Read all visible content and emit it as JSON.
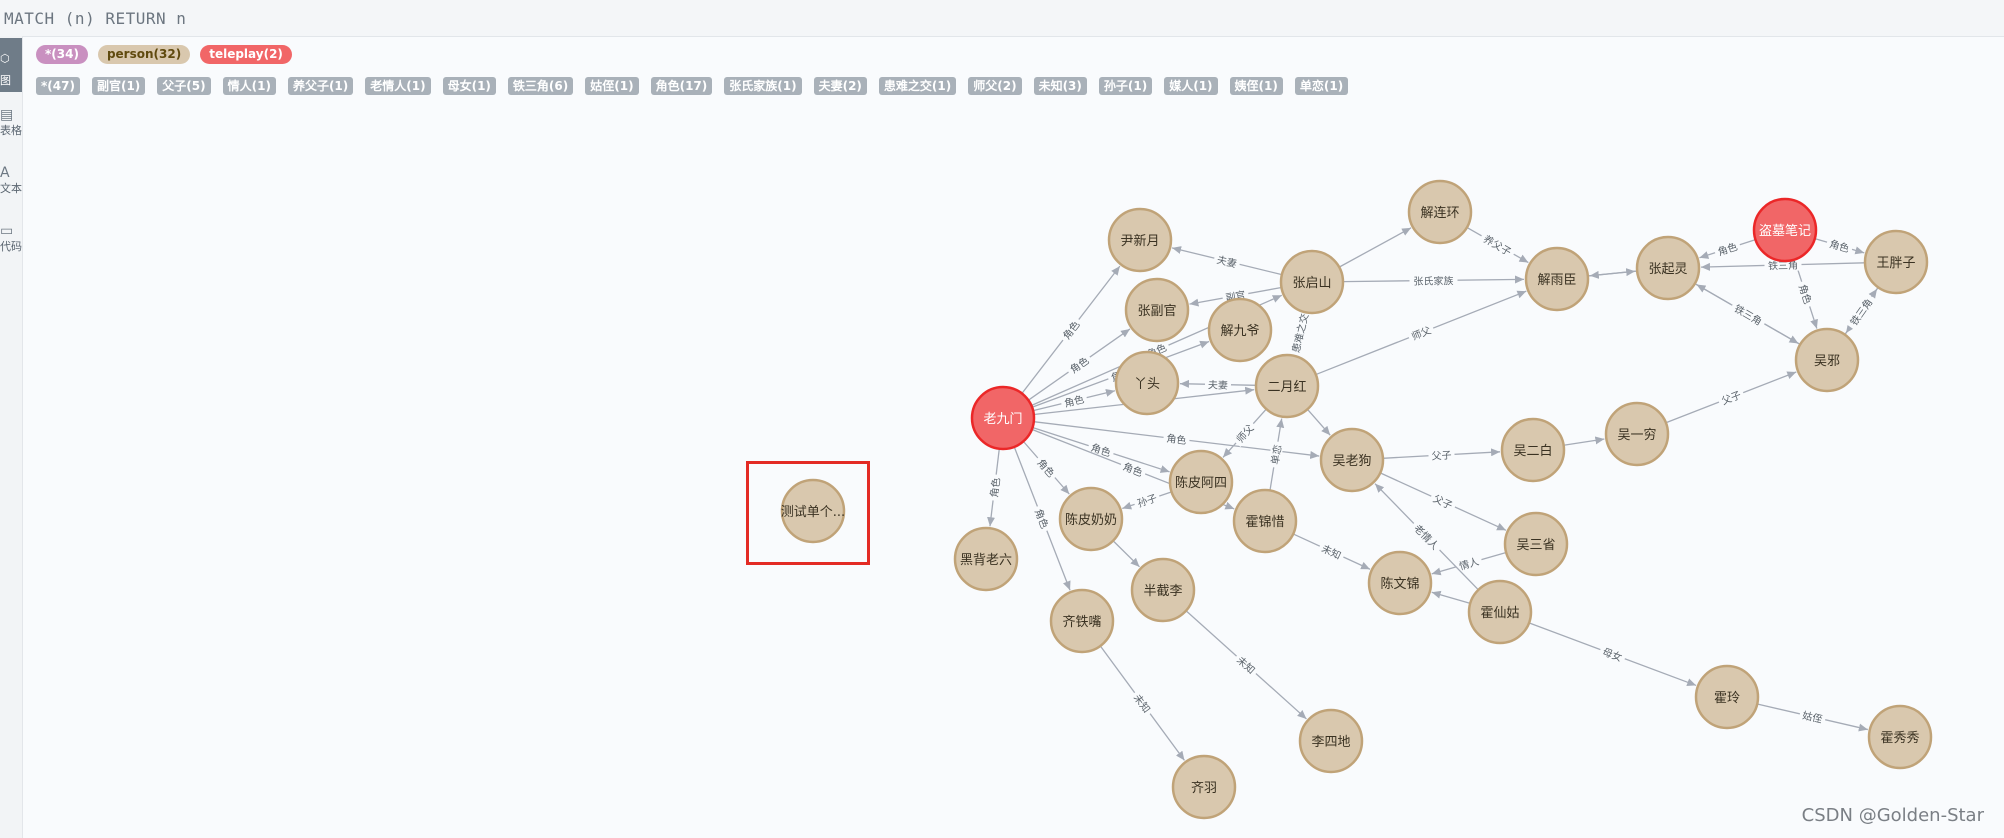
{
  "query": "MATCH (n) RETURN n",
  "sidebar": {
    "items": [
      {
        "label": "图",
        "icon": "graph-icon"
      },
      {
        "label": "表格",
        "icon": "table-icon"
      },
      {
        "label": "文本",
        "icon": "text-icon"
      },
      {
        "label": "代码",
        "icon": "code-icon"
      }
    ]
  },
  "node_labels": [
    {
      "text": "*(34)",
      "color": "#c990c0",
      "text_color": "#ffffff"
    },
    {
      "text": "person(32)",
      "color": "#d9c8ae",
      "text_color": "#604a0e"
    },
    {
      "text": "teleplay(2)",
      "color": "#f16667",
      "text_color": "#ffffff"
    }
  ],
  "rel_types": [
    "*(47)",
    "副官(1)",
    "父子(5)",
    "情人(1)",
    "养父子(1)",
    "老情人(1)",
    "母女(1)",
    "铁三角(6)",
    "姑侄(1)",
    "角色(17)",
    "张氏家族(1)",
    "夫妻(2)",
    "患难之交(1)",
    "师父(2)",
    "未知(3)",
    "孙子(1)",
    "媒人(1)",
    "姨侄(1)",
    "单恋(1)"
  ],
  "colors": {
    "person_fill": "#d9c8ae",
    "person_stroke": "#c0a378",
    "teleplay_fill": "#f16667",
    "teleplay_stroke": "#eb2728",
    "edge": "#a5abb6",
    "selection": "#e32b24"
  },
  "nodes": [
    {
      "id": "laojiumen",
      "label": "老九门",
      "type": "teleplay"
    },
    {
      "id": "daomu",
      "label": "盗墓笔记",
      "type": "teleplay"
    },
    {
      "id": "yinxinyue",
      "label": "尹新月",
      "type": "person"
    },
    {
      "id": "zhangfuguan",
      "label": "张副官",
      "type": "person"
    },
    {
      "id": "jiejiuye",
      "label": "解九爷",
      "type": "person"
    },
    {
      "id": "zhangqishan",
      "label": "张启山",
      "type": "person"
    },
    {
      "id": "jielianhuan",
      "label": "解连环",
      "type": "person"
    },
    {
      "id": "jieyuchen",
      "label": "解雨臣",
      "type": "person"
    },
    {
      "id": "zhangqiling",
      "label": "张起灵",
      "type": "person"
    },
    {
      "id": "wangpangzi",
      "label": "王胖子",
      "type": "person"
    },
    {
      "id": "wuxie",
      "label": "吴邪",
      "type": "person"
    },
    {
      "id": "yatou",
      "label": "丫头",
      "type": "person"
    },
    {
      "id": "eryuehong",
      "label": "二月红",
      "type": "person"
    },
    {
      "id": "wulaogou",
      "label": "吴老狗",
      "type": "person"
    },
    {
      "id": "wuerbai",
      "label": "吴二白",
      "type": "person"
    },
    {
      "id": "wuyiqiong",
      "label": "吴一穷",
      "type": "person"
    },
    {
      "id": "chenpiasi",
      "label": "陈皮阿四",
      "type": "person"
    },
    {
      "id": "chenpinainai",
      "label": "陈皮奶奶",
      "type": "person"
    },
    {
      "id": "huojinxi",
      "label": "霍锦惜",
      "type": "person"
    },
    {
      "id": "chenwenjin",
      "label": "陈文锦",
      "type": "person"
    },
    {
      "id": "wusanxing",
      "label": "吴三省",
      "type": "person"
    },
    {
      "id": "huoxiangu",
      "label": "霍仙姑",
      "type": "person"
    },
    {
      "id": "heibeilaoliu",
      "label": "黑背老六",
      "type": "person"
    },
    {
      "id": "banjieli",
      "label": "半截李",
      "type": "person"
    },
    {
      "id": "qitiezui",
      "label": "齐铁嘴",
      "type": "person"
    },
    {
      "id": "qiyu",
      "label": "齐羽",
      "type": "person"
    },
    {
      "id": "lisidi",
      "label": "李四地",
      "type": "person"
    },
    {
      "id": "huoling",
      "label": "霍玲",
      "type": "person"
    },
    {
      "id": "huoxiuxiu",
      "label": "霍秀秀",
      "type": "person"
    },
    {
      "id": "ceshi",
      "label": "测试单个...",
      "type": "person"
    }
  ],
  "edges": [
    {
      "from": "laojiumen",
      "to": "yinxinyue",
      "label": "角色"
    },
    {
      "from": "laojiumen",
      "to": "zhangfuguan",
      "label": "角色"
    },
    {
      "from": "laojiumen",
      "to": "jiejiuye",
      "label": "角色"
    },
    {
      "from": "laojiumen",
      "to": "yatou",
      "label": "角色"
    },
    {
      "from": "laojiumen",
      "to": "zhangqishan",
      "label": "角色"
    },
    {
      "from": "laojiumen",
      "to": "eryuehong",
      "label": "角色"
    },
    {
      "from": "laojiumen",
      "to": "wulaogou",
      "label": "角色"
    },
    {
      "from": "laojiumen",
      "to": "chenpiasi",
      "label": "角色"
    },
    {
      "from": "laojiumen",
      "to": "chenpinainai",
      "label": "角色"
    },
    {
      "from": "laojiumen",
      "to": "huojinxi",
      "label": "角色"
    },
    {
      "from": "laojiumen",
      "to": "heibeilaoliu",
      "label": "角色"
    },
    {
      "from": "laojiumen",
      "to": "qitiezui",
      "label": "角色"
    },
    {
      "from": "zhangqishan",
      "to": "yinxinyue",
      "label": "夫妻"
    },
    {
      "from": "zhangqishan",
      "to": "zhangfuguan",
      "label": "副官"
    },
    {
      "from": "zhangqishan",
      "to": "jielianhuan",
      "label": ""
    },
    {
      "from": "zhangqishan",
      "to": "jieyuchen",
      "label": "张氏家族"
    },
    {
      "from": "zhangqishan",
      "to": "eryuehong",
      "label": "患难之交"
    },
    {
      "from": "jielianhuan",
      "to": "jieyuchen",
      "label": "养父子"
    },
    {
      "from": "eryuehong",
      "to": "yatou",
      "label": "夫妻"
    },
    {
      "from": "eryuehong",
      "to": "jieyuchen",
      "label": "师父"
    },
    {
      "from": "eryuehong",
      "to": "chenpiasi",
      "label": "师父"
    },
    {
      "from": "eryuehong",
      "to": "wulaogou",
      "label": ""
    },
    {
      "from": "huojinxi",
      "to": "eryuehong",
      "label": "单恋"
    },
    {
      "from": "huojinxi",
      "to": "chenwenjin",
      "label": "未知"
    },
    {
      "from": "wulaogou",
      "to": "wuerbai",
      "label": "父子"
    },
    {
      "from": "wulaogou",
      "to": "wusanxing",
      "label": "父子"
    },
    {
      "from": "wuerbai",
      "to": "wuyiqiong",
      "label": ""
    },
    {
      "from": "wuyiqiong",
      "to": "wuxie",
      "label": "父子"
    },
    {
      "from": "chenpiasi",
      "to": "chenpinainai",
      "label": "孙子"
    },
    {
      "from": "chenpinainai",
      "to": "banjieli",
      "label": ""
    },
    {
      "from": "wusanxing",
      "to": "chenwenjin",
      "label": "情人"
    },
    {
      "from": "huoxiangu",
      "to": "wulaogou",
      "label": "老情人"
    },
    {
      "from": "huoxiangu",
      "to": "huoling",
      "label": "母女"
    },
    {
      "from": "huoxiangu",
      "to": "chenwenjin",
      "label": ""
    },
    {
      "from": "huoling",
      "to": "huoxiuxiu",
      "label": "姑侄"
    },
    {
      "from": "banjieli",
      "to": "lisidi",
      "label": "未知"
    },
    {
      "from": "qitiezui",
      "to": "qiyu",
      "label": "未知"
    },
    {
      "from": "daomu",
      "to": "zhangqiling",
      "label": "角色"
    },
    {
      "from": "daomu",
      "to": "wangpangzi",
      "label": "角色"
    },
    {
      "from": "daomu",
      "to": "wuxie",
      "label": "角色"
    },
    {
      "from": "jieyuchen",
      "to": "zhangqiling",
      "label": ""
    },
    {
      "from": "zhangqiling",
      "to": "jieyuchen",
      "label": ""
    },
    {
      "from": "wangpangzi",
      "to": "zhangqiling",
      "label": "铁三角"
    },
    {
      "from": "wangpangzi",
      "to": "wuxie",
      "label": "铁三角"
    },
    {
      "from": "wuxie",
      "to": "wangpangzi",
      "label": "铁三角"
    },
    {
      "from": "zhangqiling",
      "to": "wuxie",
      "label": "铁三角"
    },
    {
      "from": "wuxie",
      "to": "zhangqiling",
      "label": "铁三角"
    }
  ],
  "watermark": "CSDN @Golden-Star"
}
